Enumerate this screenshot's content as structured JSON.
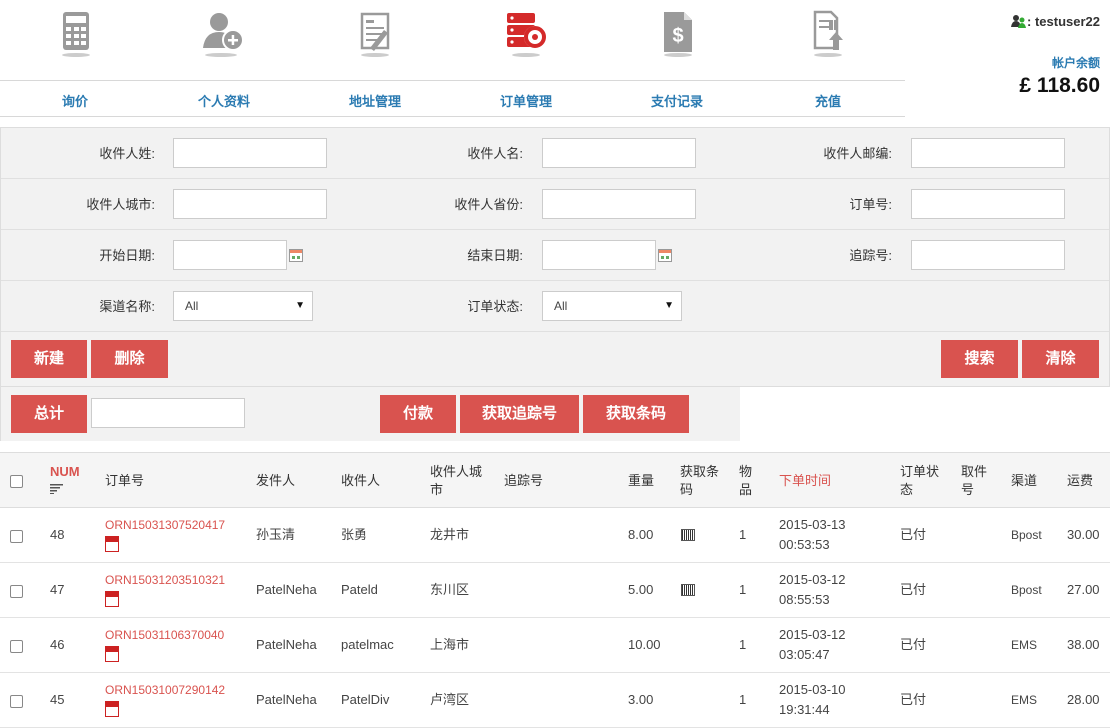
{
  "nav": [
    {
      "label": "询价",
      "icon": "calculator-icon"
    },
    {
      "label": "个人资料",
      "icon": "add-user-icon"
    },
    {
      "label": "地址管理",
      "icon": "address-form-icon"
    },
    {
      "label": "订单管理",
      "icon": "order-manage-icon",
      "active": true
    },
    {
      "label": "支付记录",
      "icon": "dollar-document-icon"
    },
    {
      "label": "充值",
      "icon": "recharge-upload-icon"
    }
  ],
  "user": {
    "prefix": ": ",
    "name": "testuser22",
    "balance_label": "帐户余额",
    "balance": "£ 118.60"
  },
  "filters": {
    "recipient_last": "收件人姓:",
    "recipient_first": "收件人名:",
    "recipient_zip": "收件人邮编:",
    "recipient_city": "收件人城市:",
    "recipient_province": "收件人省份:",
    "order_no": "订单号:",
    "start_date": "开始日期:",
    "end_date": "结束日期:",
    "tracking_no": "追踪号:",
    "channel": "渠道名称:",
    "channel_value": "All",
    "status": "订单状态:",
    "status_value": "All"
  },
  "buttons": {
    "new": "新建",
    "delete": "删除",
    "search": "搜索",
    "clear": "清除",
    "total": "总计",
    "pay": "付款",
    "get_tracking": "获取追踪号",
    "get_barcode": "获取条码"
  },
  "table": {
    "headers": {
      "num": "NUM",
      "order_no": "订单号",
      "sender": "发件人",
      "recipient": "收件人",
      "city": "收件人城\n市",
      "tracking": "追踪号",
      "weight": "重量",
      "barcode": "获取条\n码",
      "items": "物\n品",
      "order_time": "下单时间",
      "status": "订单状\n态",
      "pickup": "取件\n号",
      "channel": "渠道",
      "freight": "运费"
    },
    "rows": [
      {
        "num": "48",
        "order_no": "ORN15031307520417",
        "sender": "孙玉清",
        "recipient": "张勇",
        "city": "龙井市",
        "weight": "8.00",
        "barcode": true,
        "items": "1",
        "date": "2015-03-13",
        "time": "00:53:53",
        "status": "已付",
        "channel": "Bpost",
        "freight": "30.00"
      },
      {
        "num": "47",
        "order_no": "ORN15031203510321",
        "sender": "PatelNeha",
        "recipient": "Pateld",
        "city": "东川区",
        "weight": "5.00",
        "barcode": true,
        "items": "1",
        "date": "2015-03-12",
        "time": "08:55:53",
        "status": "已付",
        "channel": "Bpost",
        "freight": "27.00"
      },
      {
        "num": "46",
        "order_no": "ORN15031106370040",
        "sender": "PatelNeha",
        "recipient": "patelmac",
        "city": "上海市",
        "weight": "10.00",
        "barcode": false,
        "items": "1",
        "date": "2015-03-12",
        "time": "03:05:47",
        "status": "已付",
        "channel": "EMS",
        "freight": "38.00"
      },
      {
        "num": "45",
        "order_no": "ORN15031007290142",
        "sender": "PatelNeha",
        "recipient": "PatelDiv",
        "city": "卢湾区",
        "weight": "3.00",
        "barcode": false,
        "items": "1",
        "date": "2015-03-10",
        "time": "19:31:44",
        "status": "已付",
        "channel": "EMS",
        "freight": "28.00"
      }
    ]
  },
  "colors": {
    "accent": "#d9534f",
    "nav_text": "#2b7bb2",
    "icon_gray": "#9a9a9a",
    "icon_active": "#d42a2a"
  }
}
